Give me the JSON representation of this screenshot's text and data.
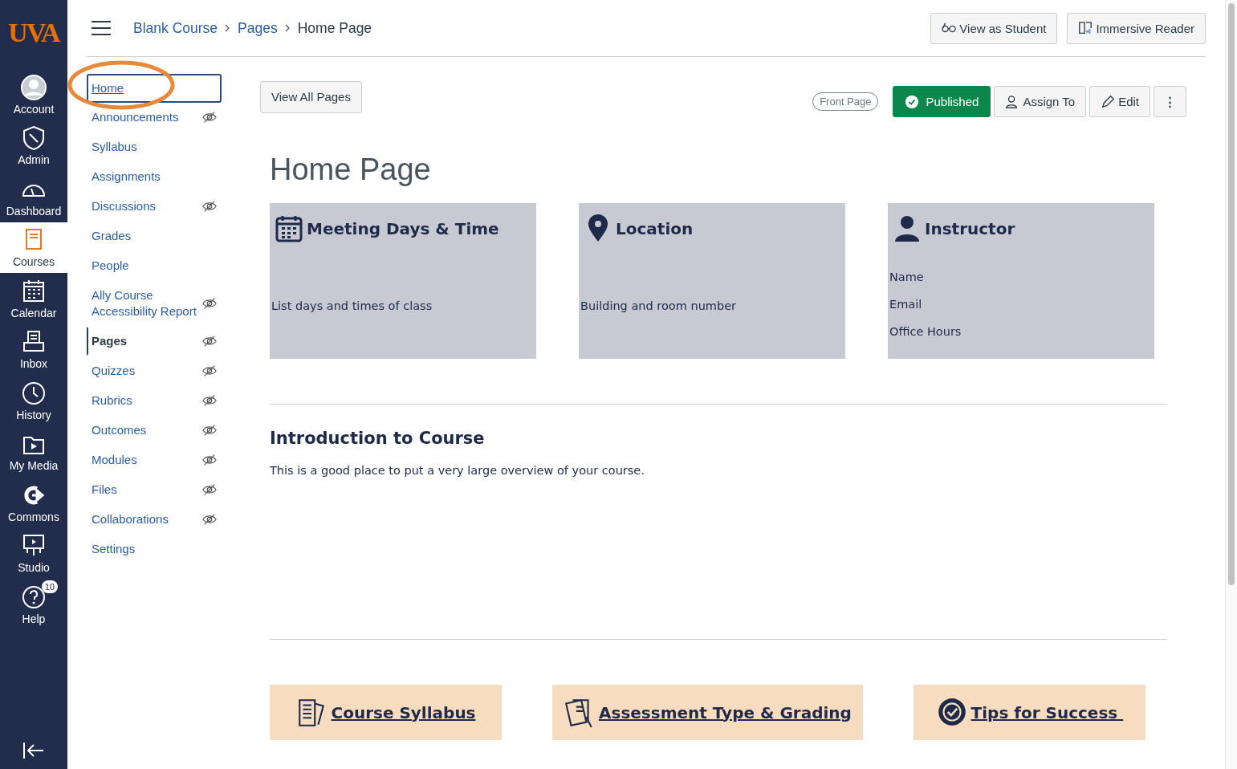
{
  "global_nav": {
    "logo": "UVA",
    "items": [
      {
        "label": "Account",
        "kind": "avatar",
        "selected": false
      },
      {
        "label": "Admin",
        "kind": "admin",
        "selected": false
      },
      {
        "label": "Dashboard",
        "kind": "dashboard",
        "selected": false
      },
      {
        "label": "Courses",
        "kind": "courses",
        "selected": true
      },
      {
        "label": "Calendar",
        "kind": "calendar",
        "selected": false
      },
      {
        "label": "Inbox",
        "kind": "inbox",
        "selected": false
      },
      {
        "label": "History",
        "kind": "history",
        "selected": false
      },
      {
        "label": "My Media",
        "kind": "media",
        "selected": false
      },
      {
        "label": "Commons",
        "kind": "commons",
        "selected": false
      },
      {
        "label": "Studio",
        "kind": "studio",
        "selected": false
      },
      {
        "label": "Help",
        "kind": "help",
        "selected": false,
        "badge": "10"
      }
    ]
  },
  "breadcrumb": [
    "Blank Course",
    "Pages",
    "Home Page"
  ],
  "header_buttons": [
    {
      "label": "View as Student",
      "kind": "glasses"
    },
    {
      "label": "Immersive Reader",
      "kind": "reader"
    }
  ],
  "course_nav": [
    {
      "label": "Home",
      "selected": false,
      "focused": true,
      "hidden": false
    },
    {
      "label": "Announcements",
      "selected": false,
      "focused": false,
      "hidden": true
    },
    {
      "label": "Syllabus",
      "selected": false,
      "focused": false,
      "hidden": false
    },
    {
      "label": "Assignments",
      "selected": false,
      "focused": false,
      "hidden": false
    },
    {
      "label": "Discussions",
      "selected": false,
      "focused": false,
      "hidden": true
    },
    {
      "label": "Grades",
      "selected": false,
      "focused": false,
      "hidden": false
    },
    {
      "label": "People",
      "selected": false,
      "focused": false,
      "hidden": false
    },
    {
      "label": "Ally Course Accessibility Report",
      "selected": false,
      "focused": false,
      "hidden": true
    },
    {
      "label": "Pages",
      "selected": true,
      "focused": false,
      "hidden": true
    },
    {
      "label": "Quizzes",
      "selected": false,
      "focused": false,
      "hidden": true
    },
    {
      "label": "Rubrics",
      "selected": false,
      "focused": false,
      "hidden": true
    },
    {
      "label": "Outcomes",
      "selected": false,
      "focused": false,
      "hidden": true
    },
    {
      "label": "Modules",
      "selected": false,
      "focused": false,
      "hidden": true
    },
    {
      "label": "Files",
      "selected": false,
      "focused": false,
      "hidden": true
    },
    {
      "label": "Collaborations",
      "selected": false,
      "focused": false,
      "hidden": true
    },
    {
      "label": "Settings",
      "selected": false,
      "focused": false,
      "hidden": false
    }
  ],
  "view_all_button": "View All Pages",
  "front_page_badge": "Front Page",
  "page_actions": [
    {
      "label": "Published",
      "kind": "published"
    },
    {
      "label": "Assign To",
      "kind": "assign"
    },
    {
      "label": "Edit",
      "kind": "edit"
    },
    {
      "label": "⋮",
      "kind": "more"
    }
  ],
  "page_title": "Home Page",
  "info_cards": [
    {
      "title": "Meeting Days & Time",
      "kind": "calendar",
      "lines": [
        "List days and times of class"
      ]
    },
    {
      "title": "Location",
      "kind": "pin",
      "lines": [
        "Building and room number"
      ]
    },
    {
      "title": "Instructor",
      "kind": "person",
      "lines": [
        "Name",
        "Email",
        "Office Hours"
      ]
    }
  ],
  "intro": {
    "heading": "Introduction to Course",
    "text": "This is a good place to put a very large overview of your course."
  },
  "link_buttons": [
    {
      "label": "Course Syllabus",
      "kind": "syllabus"
    },
    {
      "label": "Assessment Type & Grading",
      "kind": "assessment"
    },
    {
      "label": "Tips for Success ",
      "kind": "badge"
    }
  ]
}
